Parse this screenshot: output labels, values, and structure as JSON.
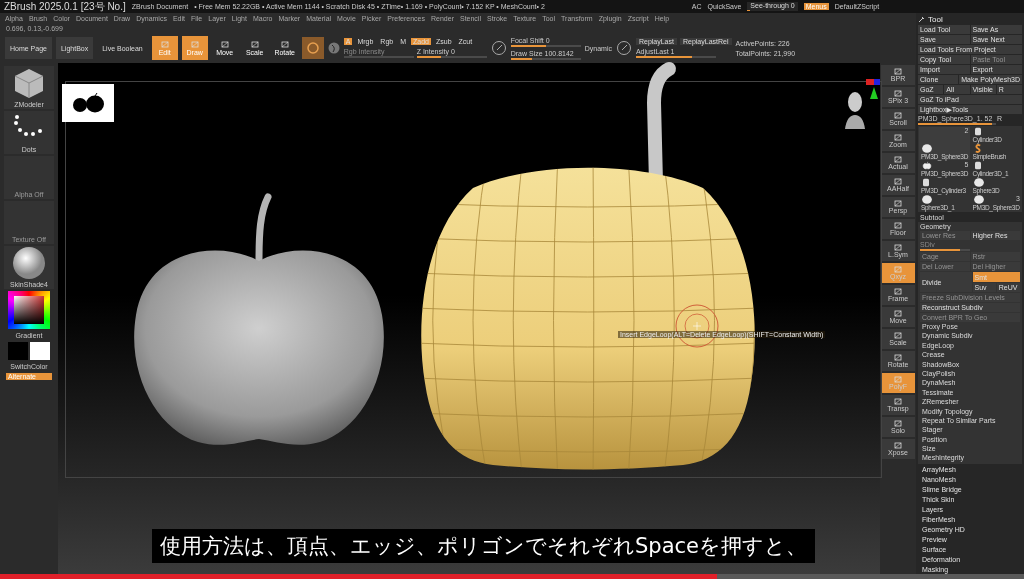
{
  "title_bar": {
    "app": "ZBrush 2025.0.1 [23号 No.]",
    "document": "ZBrush Document",
    "stats": "• Free Mem 52.22GB • Active Mem 1144 • Scratch Disk 45 • ZTime• 1.169 • PolyCount• 7.152 KP • MeshCount• 2",
    "right_items": [
      {
        "label": "AC",
        "kind": "text"
      },
      {
        "label": "QuickSave",
        "kind": "text"
      },
      {
        "label": "See-through 0",
        "kind": "slider",
        "level": 0.05
      },
      {
        "label": "Menus",
        "kind": "toggle",
        "on": true
      },
      {
        "label": "DefaultZScript",
        "kind": "text"
      }
    ]
  },
  "menu_bar": [
    "Alpha",
    "Brush",
    "Color",
    "Document",
    "Draw",
    "Dynamics",
    "Edit",
    "File",
    "Layer",
    "Light",
    "Macro",
    "Marker",
    "Material",
    "Movie",
    "Picker",
    "Preferences",
    "Render",
    "Stencil",
    "Stroke",
    "Texture",
    "Tool",
    "Transform",
    "Zplugin",
    "Zscript",
    "Help"
  ],
  "coordinates": "0.696, 0.13,-0.699",
  "top_shelf": {
    "nav_buttons": [
      "Home Page",
      "LightBox",
      "Live Boolean"
    ],
    "tools": [
      {
        "label": "Edit",
        "selected": true
      },
      {
        "label": "Draw",
        "selected": true
      },
      {
        "label": "Move",
        "selected": false
      },
      {
        "label": "Scale",
        "selected": false
      },
      {
        "label": "Rotate",
        "selected": false
      }
    ],
    "channels": [
      {
        "label": "A",
        "on": true
      },
      {
        "label": "Mrgb",
        "on": false
      },
      {
        "label": "Rgb",
        "on": false
      },
      {
        "label": "M",
        "on": false
      },
      {
        "label": "Zadd",
        "on": true
      },
      {
        "label": "Zsub",
        "on": false
      },
      {
        "label": "Zcut",
        "on": false
      }
    ],
    "intensity_sliders": [
      {
        "label": "Rgb Intensity",
        "disabled": true
      },
      {
        "label": "Z Intensity 0",
        "level": 0.35
      }
    ],
    "brush_sliders": [
      {
        "label": "Focal Shift 0",
        "level": 0.5
      },
      {
        "label": "Draw Size 100.8142",
        "level": 0.3
      }
    ],
    "dynamic": "Dynamic",
    "replay_buttons": [
      "ReplayLast",
      "ReplayLastRel"
    ],
    "adjust_last": {
      "label": "AdjustLast 1",
      "level": 0.7
    },
    "active_points": "ActivePoints: 226",
    "total_points": "TotalPoints: 21,990"
  },
  "left_shelf": {
    "items": [
      {
        "label": "ZModeler",
        "kind": "cube"
      },
      {
        "label": "Dots",
        "kind": "dots"
      },
      {
        "label": "Alpha Off",
        "kind": "empty"
      },
      {
        "label": "Texture Off",
        "kind": "empty"
      },
      {
        "label": "SkinShade4",
        "kind": "sphere"
      }
    ],
    "gradient": "Gradient",
    "switch_color": "SwitchColor",
    "alternate": "Alternate"
  },
  "canvas": {
    "hint": "Insert EdgeLoop(ALT=Delete EdgeLoop)(SHIFT=Constant Width)"
  },
  "right_shelf": [
    {
      "label": "BPR",
      "on": false
    },
    {
      "label": "SPix 3",
      "on": false
    },
    {
      "label": "Scroll",
      "on": false
    },
    {
      "label": "Zoom",
      "on": false
    },
    {
      "label": "Actual",
      "on": false
    },
    {
      "label": "AAHalf",
      "on": false
    },
    {
      "label": "Persp",
      "on": false
    },
    {
      "label": "Floor",
      "on": false
    },
    {
      "label": "L.Sym",
      "on": false
    },
    {
      "label": "Qxyz",
      "on": true
    },
    {
      "label": "Frame",
      "on": false
    },
    {
      "label": "Move",
      "on": false
    },
    {
      "label": "Scale",
      "on": false
    },
    {
      "label": "Rotate",
      "on": false
    },
    {
      "label": "PolyF",
      "on": true
    },
    {
      "label": "Transp",
      "on": false
    },
    {
      "label": "Solo",
      "on": false
    },
    {
      "label": "Xpose",
      "on": false
    }
  ],
  "tool_panel": {
    "title": "Tool",
    "button_rows": [
      [
        {
          "label": "Load Tool",
          "disabled": false
        },
        {
          "label": "Save As",
          "disabled": false
        }
      ],
      [
        {
          "label": "Save",
          "disabled": false
        },
        {
          "label": "Save Next",
          "disabled": false
        }
      ],
      [
        {
          "label": "Load Tools From Project",
          "disabled": false
        }
      ],
      [
        {
          "label": "Copy Tool",
          "disabled": false
        },
        {
          "label": "Paste Tool",
          "disabled": true
        }
      ],
      [
        {
          "label": "Import",
          "disabled": false
        },
        {
          "label": "Export",
          "disabled": false
        }
      ],
      [
        {
          "label": "Clone",
          "disabled": false
        },
        {
          "label": "Make PolyMesh3D",
          "disabled": false
        }
      ],
      [
        {
          "label": "GoZ",
          "disabled": false
        },
        {
          "label": "All",
          "disabled": false
        },
        {
          "label": "Visible",
          "disabled": false
        },
        {
          "label": "R",
          "disabled": false
        }
      ],
      [
        {
          "label": "GoZ To iPad",
          "disabled": false
        }
      ],
      [
        {
          "label": "Lightbox▶Tools",
          "disabled": false
        }
      ]
    ],
    "current_tool": {
      "label": "PM3D_Sphere3D_1. 52",
      "level": 0.95,
      "reset": "R"
    },
    "thumbnail_columns": [
      [
        {
          "label": "PM3D_Sphere3D",
          "count": "2",
          "kind": "sphere",
          "selected": true
        },
        {
          "label": "PM3D_Sphere3D",
          "count": "5",
          "kind": "apple",
          "selected": false
        },
        {
          "label": "PM3D_Cylinder3",
          "kind": "cylinder",
          "selected": false
        },
        {
          "label": "Sphere3D_1",
          "kind": "sphere",
          "selected": false
        }
      ],
      [
        {
          "label": "Cylinder3D",
          "kind": "cylinder",
          "selected": false
        },
        {
          "label": "SimpleBrush",
          "kind": "brush",
          "selected": false
        },
        {
          "label": "Cylinder3D_1",
          "kind": "cylinder",
          "selected": false
        },
        {
          "label": "Sphere3D",
          "kind": "sphere",
          "selected": false
        },
        {
          "label": "PM3D_Sphere3D",
          "count": "3",
          "kind": "sphere",
          "selected": false
        }
      ]
    ],
    "subtool": "Subtool",
    "geometry": {
      "title": "Geometry",
      "rows": [
        [
          {
            "label": "Lower Res",
            "disabled": true
          },
          {
            "label": "Higher Res",
            "disabled": false
          }
        ],
        [
          {
            "label": "SDiv",
            "kind": "slider",
            "disabled": true,
            "level": 0.8
          }
        ],
        [
          {
            "label": "Cage",
            "disabled": true
          },
          {
            "label": "Rstr",
            "disabled": true
          }
        ],
        [
          {
            "label": "Del Lower",
            "disabled": true
          },
          {
            "label": "Del Higher",
            "disabled": true
          }
        ]
      ],
      "divide": "Divide",
      "divide_options": [
        {
          "label": "Smt",
          "on": true
        },
        {
          "label": "Suv",
          "on": false
        },
        {
          "label": "ReUV",
          "on": false
        }
      ],
      "actions": [
        {
          "label": "Freeze SubDivision Levels",
          "disabled": true
        },
        {
          "label": "Reconstruct Subdiv",
          "disabled": false
        },
        {
          "label": "Convert BPR To Geo",
          "disabled": true
        }
      ],
      "items": [
        "Proxy Pose",
        "Dynamic Subdiv",
        "EdgeLoop",
        "Crease",
        "ShadowBox",
        "ClayPolish",
        "DynaMesh",
        "Tessimate",
        "ZRemesher",
        "Modify Topology",
        "Repeat To Similar Parts",
        "Stager",
        "Position",
        "Size",
        "MeshIntegrity"
      ]
    },
    "sections": [
      "ArrayMesh",
      "NanoMesh",
      "Slime Bridge",
      "Thick Skin",
      "Layers",
      "FiberMesh",
      "Geometry HD",
      "Preview",
      "Surface",
      "Deformation",
      "Masking"
    ]
  },
  "subtitle": "使用方法は、頂点、エッジ、ポリゴンでそれぞれSpaceを押すと、",
  "video_progress": {
    "level": 0.7
  }
}
